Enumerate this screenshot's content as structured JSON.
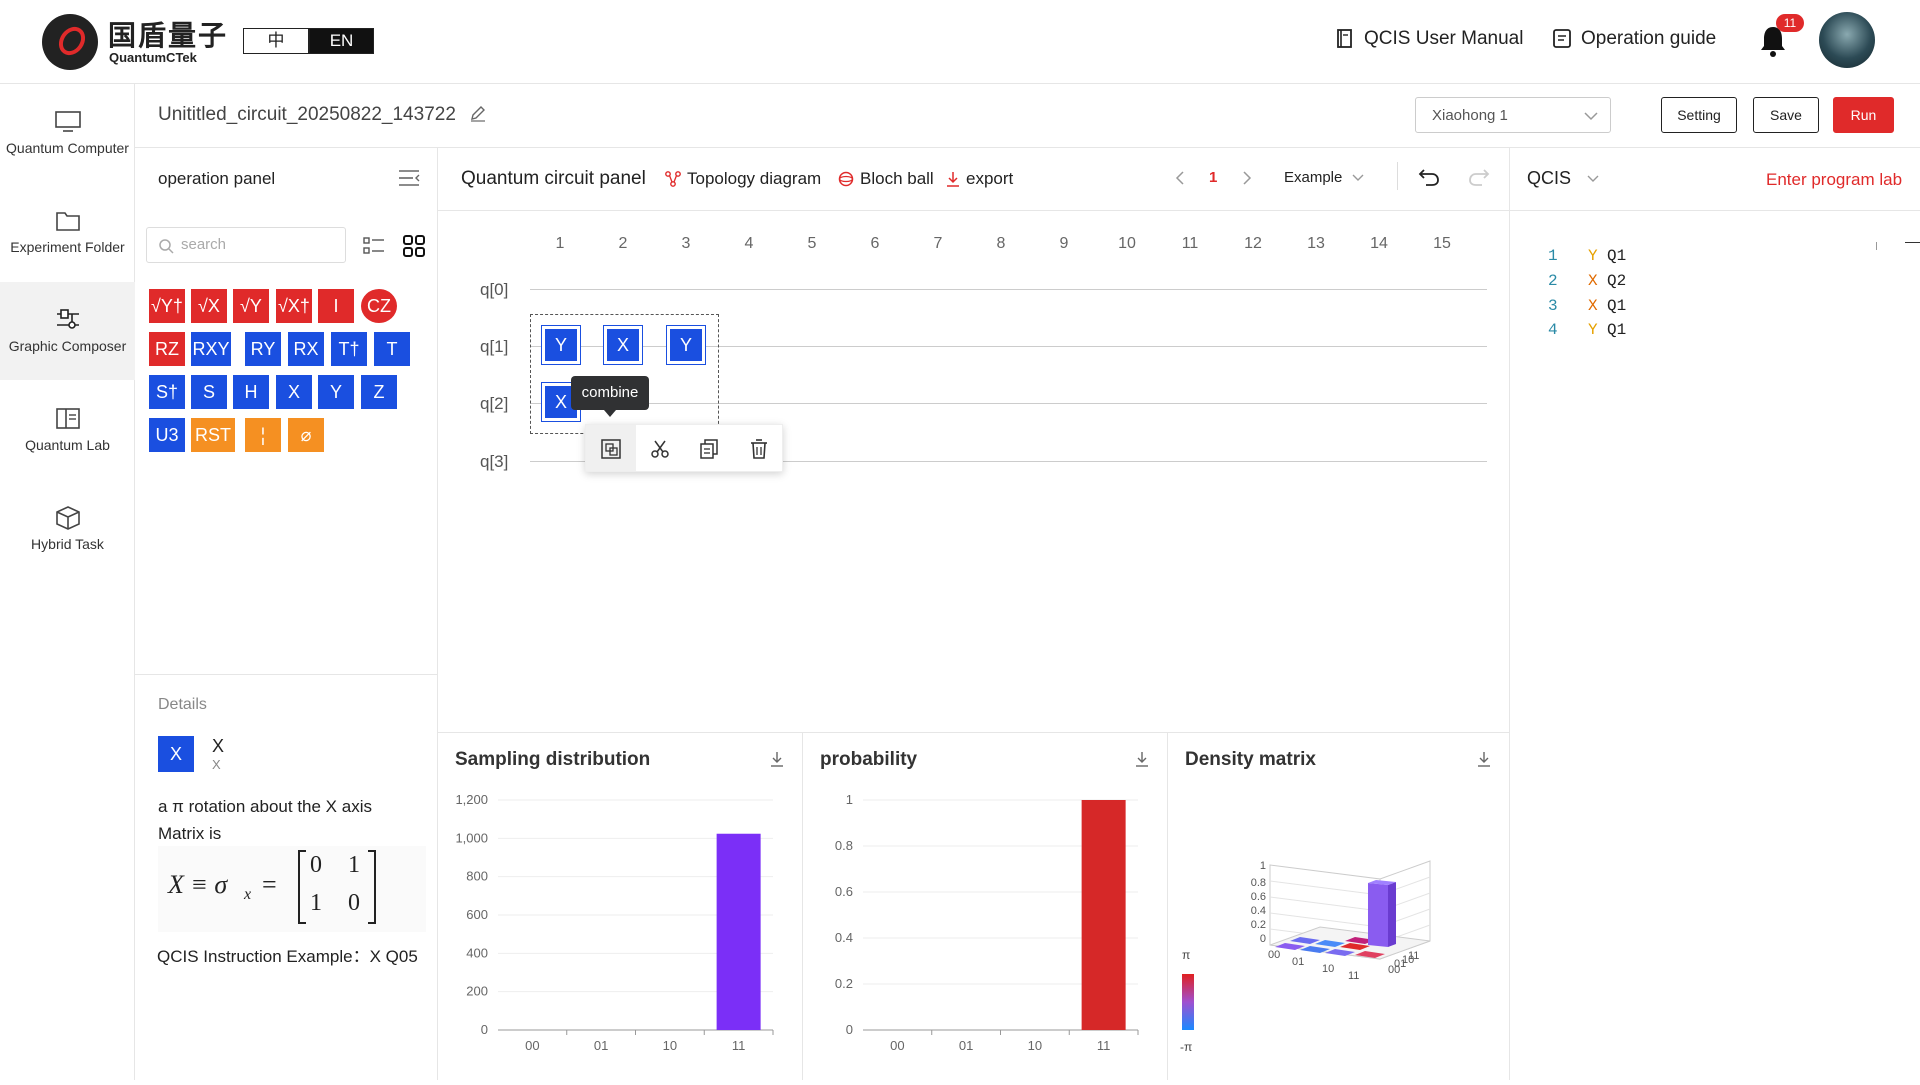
{
  "header": {
    "logo_cn": "国盾量子",
    "logo_en": "QuantumCTek",
    "lang_cn": "中",
    "lang_en": "EN",
    "user_manual": "QCIS User Manual",
    "operation_guide": "Operation guide",
    "notification_count": "11"
  },
  "nav": [
    {
      "label": "Quantum Computer",
      "icon": "monitor-icon"
    },
    {
      "label": "Experiment Folder",
      "icon": "folder-icon"
    },
    {
      "label": "Graphic Composer",
      "icon": "composer-icon",
      "active": true
    },
    {
      "label": "Quantum Lab",
      "icon": "book-icon"
    },
    {
      "label": "Hybrid Task",
      "icon": "cube-icon"
    }
  ],
  "title_row": {
    "circuit_name": "Unititled_circuit_20250822_143722",
    "computer_select": "Xiaohong 1",
    "setting": "Setting",
    "save": "Save",
    "run": "Run"
  },
  "operation_panel": {
    "title": "operation panel",
    "search_placeholder": "search",
    "gates_row1": [
      "√Y†",
      "√X",
      "√Y",
      "√X†",
      "I",
      "CZ"
    ],
    "gates_row2": [
      "RZ",
      "RXY",
      "RY",
      "RX",
      "T†",
      "T"
    ],
    "gates_row3": [
      "S†",
      "S",
      "H",
      "X",
      "Y",
      "Z"
    ],
    "gates_row4": [
      "U3",
      "RST",
      "¦",
      "⌀"
    ]
  },
  "details": {
    "title": "Details",
    "gate": "X",
    "gate_name": "X",
    "gate_sub": "X",
    "description": "a π rotation about the X axis",
    "matrix_label": "Matrix is",
    "formula_lhs": "X ≡ σ",
    "formula_sub": "x",
    "formula_eq": "=",
    "matrix": [
      "0",
      "1",
      "1",
      "0"
    ],
    "qcis_example": "QCIS Instruction Example：X Q05"
  },
  "circuit_panel": {
    "title": "Quantum circuit panel",
    "topology": "Topology diagram",
    "bloch": "Bloch ball",
    "export": "export",
    "page": "1",
    "example": "Example",
    "columns": [
      "1",
      "2",
      "3",
      "4",
      "5",
      "6",
      "7",
      "8",
      "9",
      "10",
      "11",
      "12",
      "13",
      "14",
      "15"
    ],
    "qubits": [
      "q[0]",
      "q[1]",
      "q[2]",
      "q[3]"
    ],
    "gates": [
      {
        "label": "Y",
        "qubit": 1,
        "col": 1
      },
      {
        "label": "X",
        "qubit": 1,
        "col": 2
      },
      {
        "label": "Y",
        "qubit": 1,
        "col": 3
      },
      {
        "label": "X",
        "qubit": 2,
        "col": 1
      }
    ],
    "tooltip": "combine",
    "toolbox_icons": [
      "combine-icon",
      "cut-icon",
      "copy-icon",
      "delete-icon"
    ]
  },
  "qcis_panel": {
    "title": "QCIS",
    "enter_lab": "Enter program lab",
    "lines": [
      {
        "n": "1",
        "op": "Y",
        "q": "Q1"
      },
      {
        "n": "2",
        "op": "X",
        "q": "Q2"
      },
      {
        "n": "3",
        "op": "X",
        "q": "Q1"
      },
      {
        "n": "4",
        "op": "Y",
        "q": "Q1"
      }
    ]
  },
  "colors": {
    "red": "#e02a2a",
    "blue": "#1a4fe0",
    "orange": "#f59022",
    "purple": "#7b2ff7"
  },
  "chart_data": [
    {
      "type": "bar",
      "title": "Sampling distribution",
      "categories": [
        "00",
        "01",
        "10",
        "11"
      ],
      "values": [
        0,
        0,
        0,
        1024
      ],
      "yticks": [
        "1,200",
        "1,000",
        "800",
        "600",
        "400",
        "200",
        "0"
      ],
      "ylim": [
        0,
        1200
      ],
      "color": "#7b2ff7"
    },
    {
      "type": "bar",
      "title": "probability",
      "categories": [
        "00",
        "01",
        "10",
        "11"
      ],
      "values": [
        0,
        0,
        0,
        1
      ],
      "yticks": [
        "1",
        "0.8",
        "0.6",
        "0.4",
        "0.2",
        "0"
      ],
      "ylim": [
        0,
        1
      ],
      "color": "#d62828"
    },
    {
      "type": "bar3d",
      "title": "Density matrix",
      "categories": [
        "00",
        "01",
        "10",
        "11"
      ],
      "zticks": [
        "1",
        "0.8",
        "0.6",
        "0.4",
        "0.2",
        "0"
      ],
      "value_11_11": 1,
      "colorbar": [
        "π",
        "-π"
      ]
    }
  ]
}
